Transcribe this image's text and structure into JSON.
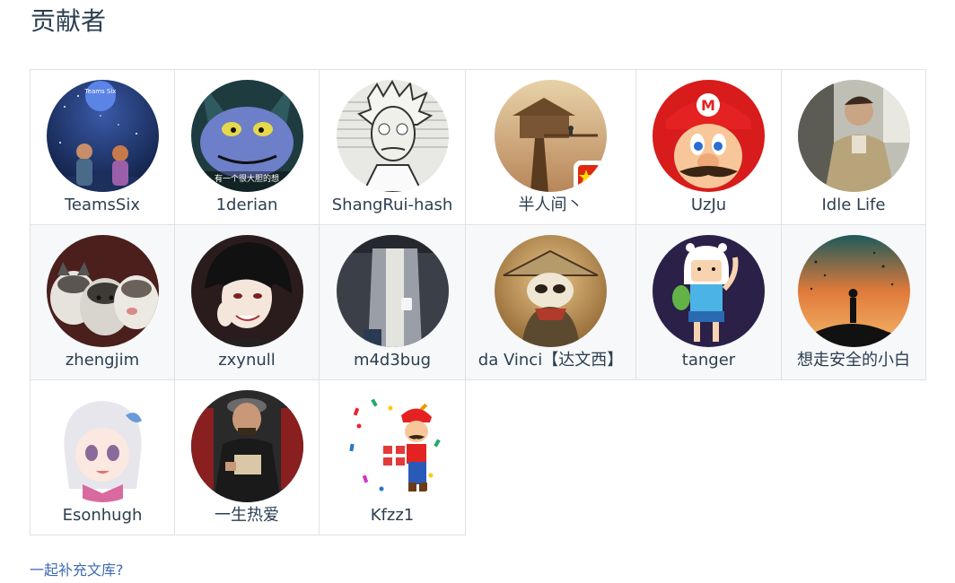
{
  "heading": "贡献者",
  "footer_link": "一起补充文库?",
  "contributors": [
    {
      "name": "TeamsSix",
      "avatar": "starry-night-children-icon"
    },
    {
      "name": "1derian",
      "avatar": "cartoon-cat-icon"
    },
    {
      "name": "ShangRui-hash",
      "avatar": "rick-cartoon-icon"
    },
    {
      "name": "半人间丶",
      "avatar": "treehouse-icon"
    },
    {
      "name": "UzJu",
      "avatar": "mario-face-icon"
    },
    {
      "name": "Idle Life",
      "avatar": "man-photo-icon"
    },
    {
      "name": "zhengjim",
      "avatar": "husky-puppies-icon"
    },
    {
      "name": "zxynull",
      "avatar": "anime-boy-icon"
    },
    {
      "name": "m4d3bug",
      "avatar": "person-cardigan-icon"
    },
    {
      "name": "da Vinci【达文西】",
      "avatar": "samurai-panda-icon"
    },
    {
      "name": "tanger",
      "avatar": "finn-cartoon-icon"
    },
    {
      "name": "想走安全的小白",
      "avatar": "sunset-silhouette-icon"
    },
    {
      "name": "Esonhugh",
      "avatar": "anime-girl-icon"
    },
    {
      "name": "一生热爱",
      "avatar": "man-holding-box-icon"
    },
    {
      "name": "Kfzz1",
      "avatar": "mario-gift-icon"
    }
  ],
  "avatar_badges": {
    "teamssix_badge": "Teams Six",
    "cat_caption": "有一个很大胆的想"
  },
  "colors": {
    "heading": "#2c3e50",
    "link": "#3e6bb0",
    "border": "#dfe2e5",
    "alt_row": "#f6f8fa"
  }
}
